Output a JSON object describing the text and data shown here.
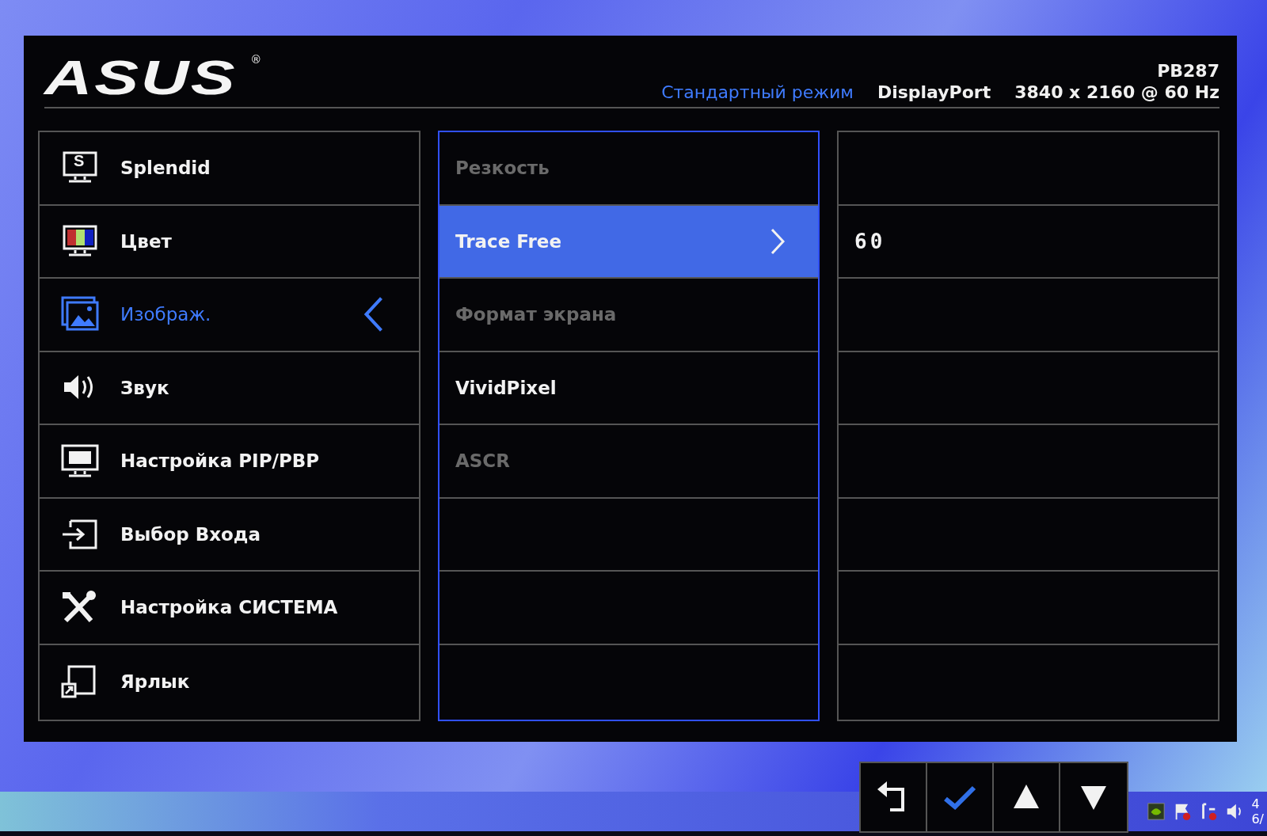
{
  "header": {
    "logo": "ASUS",
    "logo_mark": "®",
    "model": "PB287",
    "mode": "Стандартный режим",
    "input": "DisplayPort",
    "resolution": "3840 x 2160 @ 60 Hz"
  },
  "main_menu": [
    {
      "label": "Splendid",
      "selected": false,
      "icon_letter": "S"
    },
    {
      "label": "Цвет",
      "selected": false
    },
    {
      "label": "Изображ.",
      "selected": true
    },
    {
      "label": "Звук",
      "selected": false
    },
    {
      "label": "Настройка PIP/PBP",
      "selected": false
    },
    {
      "label": "Выбор Входа",
      "selected": false
    },
    {
      "label": "Настройка СИСТЕМА",
      "selected": false
    },
    {
      "label": "Ярлык",
      "selected": false
    }
  ],
  "submenu": [
    {
      "label": "Резкость",
      "selected": false,
      "disabled": true
    },
    {
      "label": "Trace Free",
      "selected": true,
      "disabled": false
    },
    {
      "label": "Формат экрана",
      "selected": false,
      "disabled": true
    },
    {
      "label": "VividPixel",
      "selected": false,
      "disabled": false
    },
    {
      "label": "ASCR",
      "selected": false,
      "disabled": true
    }
  ],
  "value_panel": {
    "value": "60"
  },
  "taskbar": {
    "clock_line_1": "4",
    "clock_line_2": "6/"
  }
}
